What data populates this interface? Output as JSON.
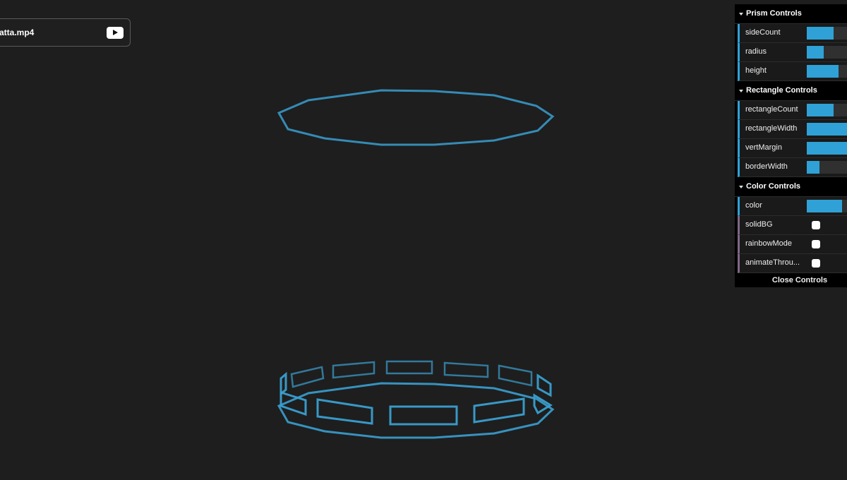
{
  "video": {
    "filename": "atta.mp4",
    "play_icon": "play-icon"
  },
  "colors": {
    "accent": "#2fa1d6",
    "shape": "#3a9fd0",
    "background": "#1e1e1e"
  },
  "gui": {
    "folders": [
      {
        "title": "Prism Controls",
        "controls": [
          {
            "label": "sideCount",
            "type": "slider",
            "fill_percent": 38
          },
          {
            "label": "radius",
            "type": "slider",
            "fill_percent": 24
          },
          {
            "label": "height",
            "type": "slider",
            "fill_percent": 45
          }
        ]
      },
      {
        "title": "Rectangle Controls",
        "controls": [
          {
            "label": "rectangleCount",
            "type": "slider",
            "fill_percent": 38
          },
          {
            "label": "rectangleWidth",
            "type": "slider",
            "fill_percent": 100
          },
          {
            "label": "vertMargin",
            "type": "slider",
            "fill_percent": 100
          },
          {
            "label": "borderWidth",
            "type": "slider",
            "fill_percent": 18
          }
        ]
      },
      {
        "title": "Color Controls",
        "controls": [
          {
            "label": "color",
            "type": "slider",
            "fill_percent": 50
          },
          {
            "label": "solidBG",
            "type": "checkbox",
            "checked": false
          },
          {
            "label": "rainbowMode",
            "type": "checkbox",
            "checked": false
          },
          {
            "label": "animateThrou...",
            "type": "checkbox",
            "checked": false
          }
        ]
      }
    ],
    "close_label": "Close Controls"
  }
}
